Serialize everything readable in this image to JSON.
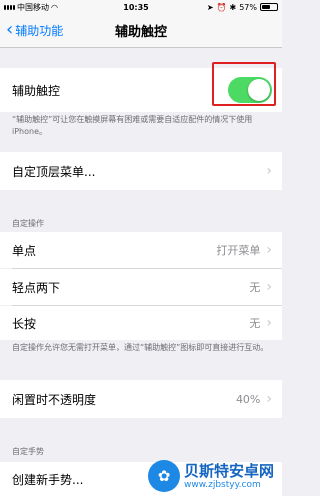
{
  "status_bar": {
    "carrier": "中国移动",
    "time": "10:35",
    "battery": "57%",
    "battery_level": 0.57
  },
  "nav": {
    "back_label": "辅助功能",
    "title": "辅助触控"
  },
  "assistive_touch": {
    "label": "辅助触控",
    "enabled": true,
    "description": "“辅助触控”可让您在触摸屏幕有困难或需要自适应配件的情况下使用 iPhone。"
  },
  "custom_menu": {
    "label": "自定顶层菜单..."
  },
  "custom_actions": {
    "header": "自定操作",
    "rows": [
      {
        "label": "单点",
        "value": "打开菜单"
      },
      {
        "label": "轻点两下",
        "value": "无"
      },
      {
        "label": "长按",
        "value": "无"
      }
    ],
    "footer": "自定操作允许您无需打开菜单，通过“辅助触控”图标即可直接进行互动。"
  },
  "idle_opacity": {
    "label": "闲置时不透明度",
    "value": "40%"
  },
  "custom_gestures": {
    "header": "自定手势",
    "new_gesture": "创建新手势..."
  },
  "watermark": {
    "title": "贝斯特安卓网",
    "url": "www.zjbstyy.com"
  },
  "colors": {
    "accent": "#007aff",
    "toggle_on": "#4cd964",
    "highlight": "#e02020"
  }
}
